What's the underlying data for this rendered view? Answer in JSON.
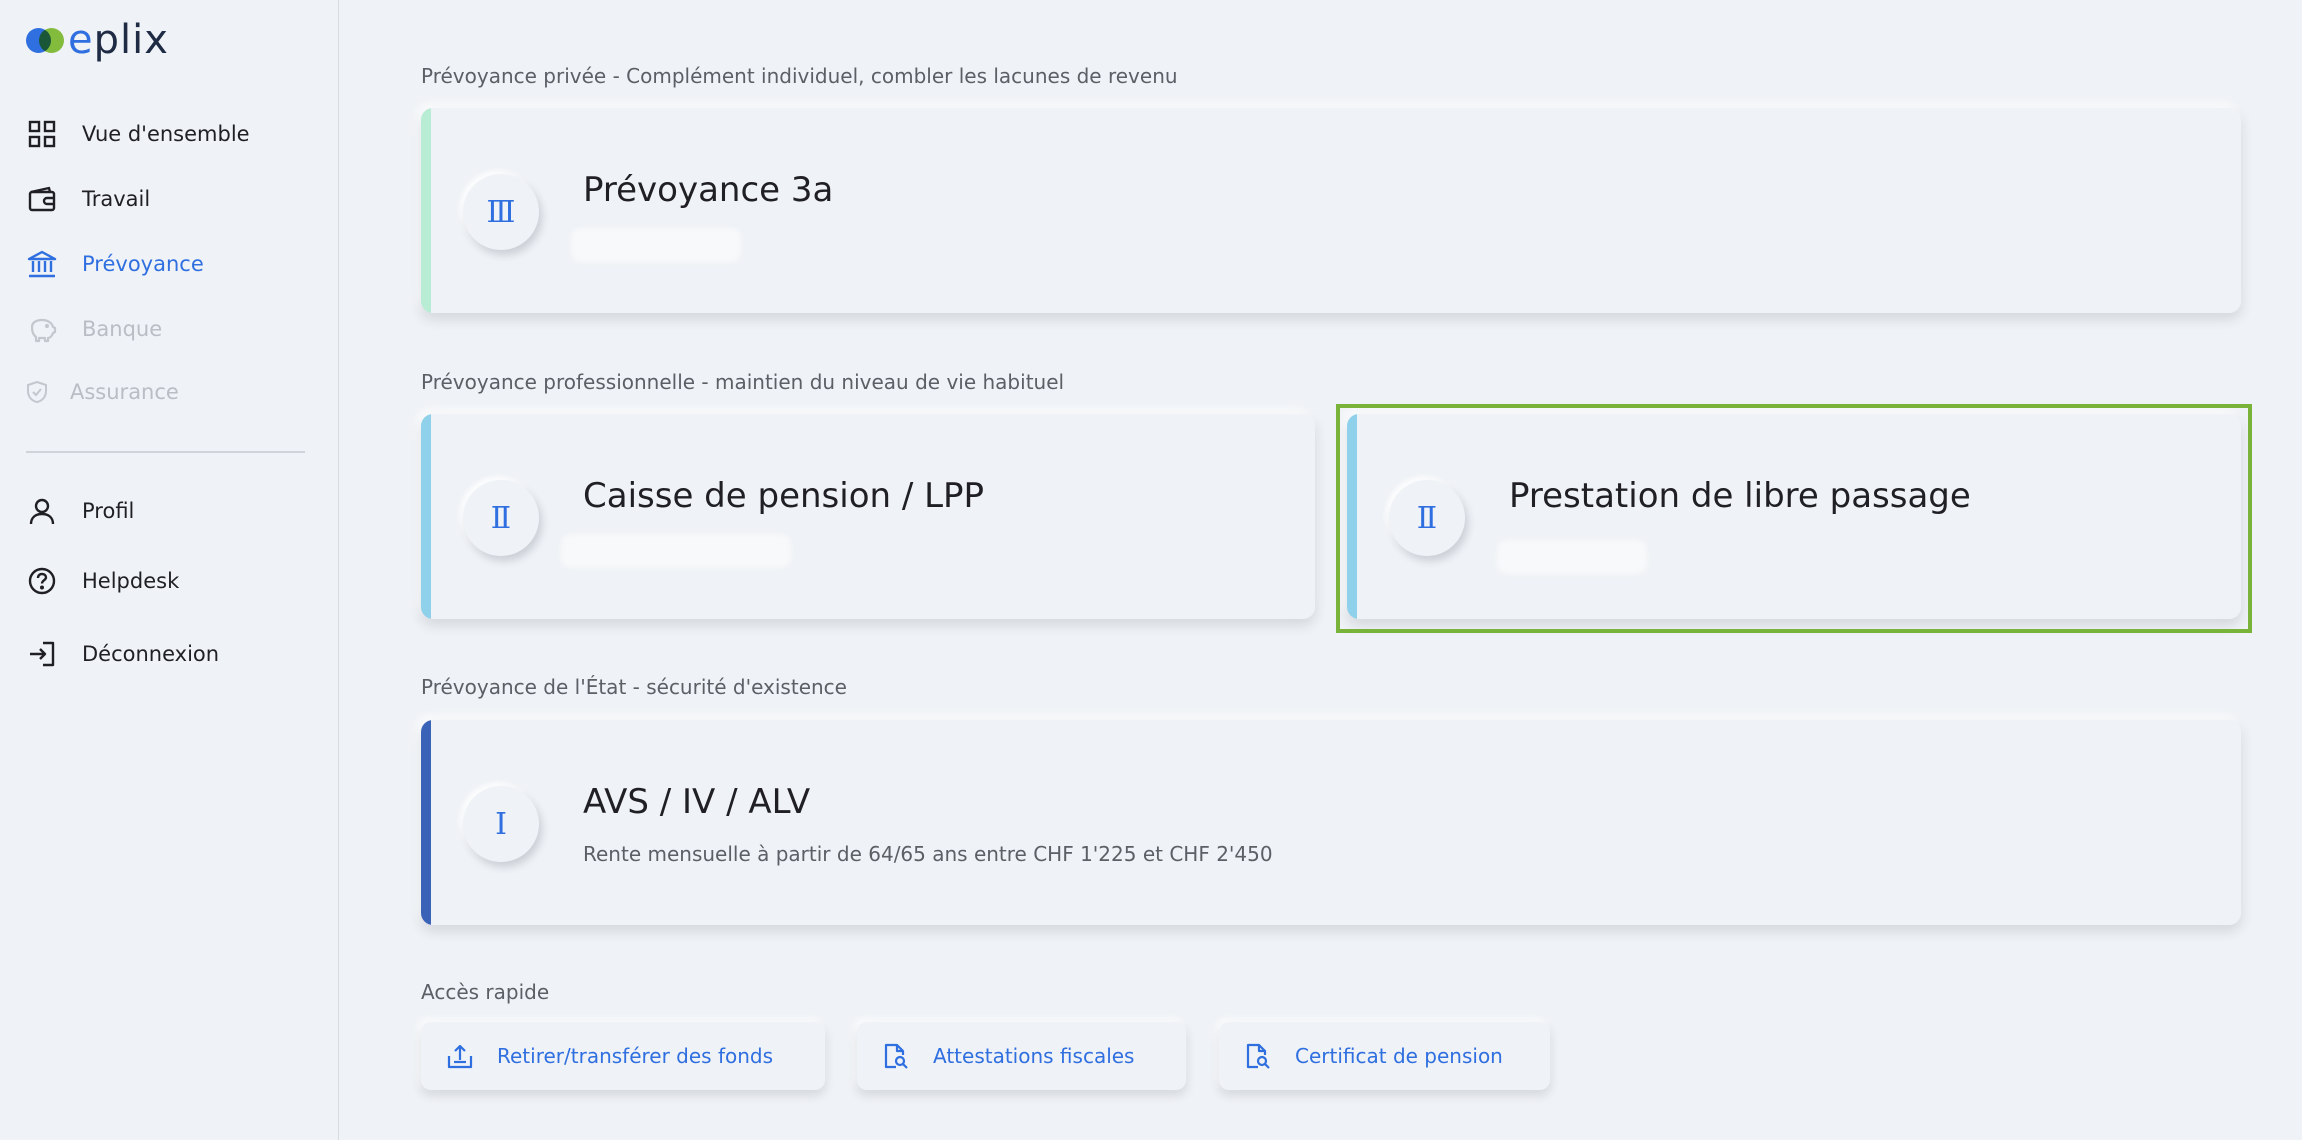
{
  "brand": {
    "name_first": "e",
    "name_rest": "plix"
  },
  "nav": {
    "items": [
      {
        "label": "Vue d'ensemble",
        "icon": "grid-icon",
        "state": "normal"
      },
      {
        "label": "Travail",
        "icon": "wallet-icon",
        "state": "normal"
      },
      {
        "label": "Prévoyance",
        "icon": "bank-icon",
        "state": "active"
      },
      {
        "label": "Banque",
        "icon": "piggy-bank-icon",
        "state": "disabled"
      },
      {
        "label": "Assurance",
        "icon": "shield-icon",
        "state": "disabled"
      }
    ],
    "secondary": [
      {
        "label": "Profil",
        "icon": "user-icon"
      },
      {
        "label": "Helpdesk",
        "icon": "help-circle-icon"
      },
      {
        "label": "Déconnexion",
        "icon": "logout-icon"
      }
    ]
  },
  "sections": {
    "private": {
      "title": "Prévoyance privée - Complément individuel, combler les lacunes de revenu",
      "card": {
        "badge": "Ⅲ",
        "title": "Prévoyance 3a",
        "accent": "#b8ecd4"
      }
    },
    "professional": {
      "title": "Prévoyance professionnelle - maintien du niveau de vie habituel",
      "cards": [
        {
          "badge": "Ⅱ",
          "title": "Caisse de pension / LPP",
          "accent": "#8fd1ea"
        },
        {
          "badge": "Ⅱ",
          "title": "Prestation de libre passage",
          "accent": "#8fd1ea"
        }
      ]
    },
    "state": {
      "title": "Prévoyance de l'État - sécurité d'existence",
      "card": {
        "badge": "Ⅰ",
        "title": "AVS / IV / ALV",
        "subtitle": "Rente mensuelle à partir de 64/65 ans entre CHF 1'225 et CHF 2'450",
        "accent": "#3a63b8"
      }
    }
  },
  "quick_access": {
    "title": "Accès rapide",
    "buttons": [
      {
        "label": "Retirer/transférer des fonds",
        "icon": "upload-tray-icon"
      },
      {
        "label": "Attestations fiscales",
        "icon": "document-search-icon"
      },
      {
        "label": "Certificat de pension",
        "icon": "document-search-icon"
      }
    ]
  },
  "colors": {
    "primary": "#2f6fe0",
    "highlight": "#7ab33a"
  }
}
